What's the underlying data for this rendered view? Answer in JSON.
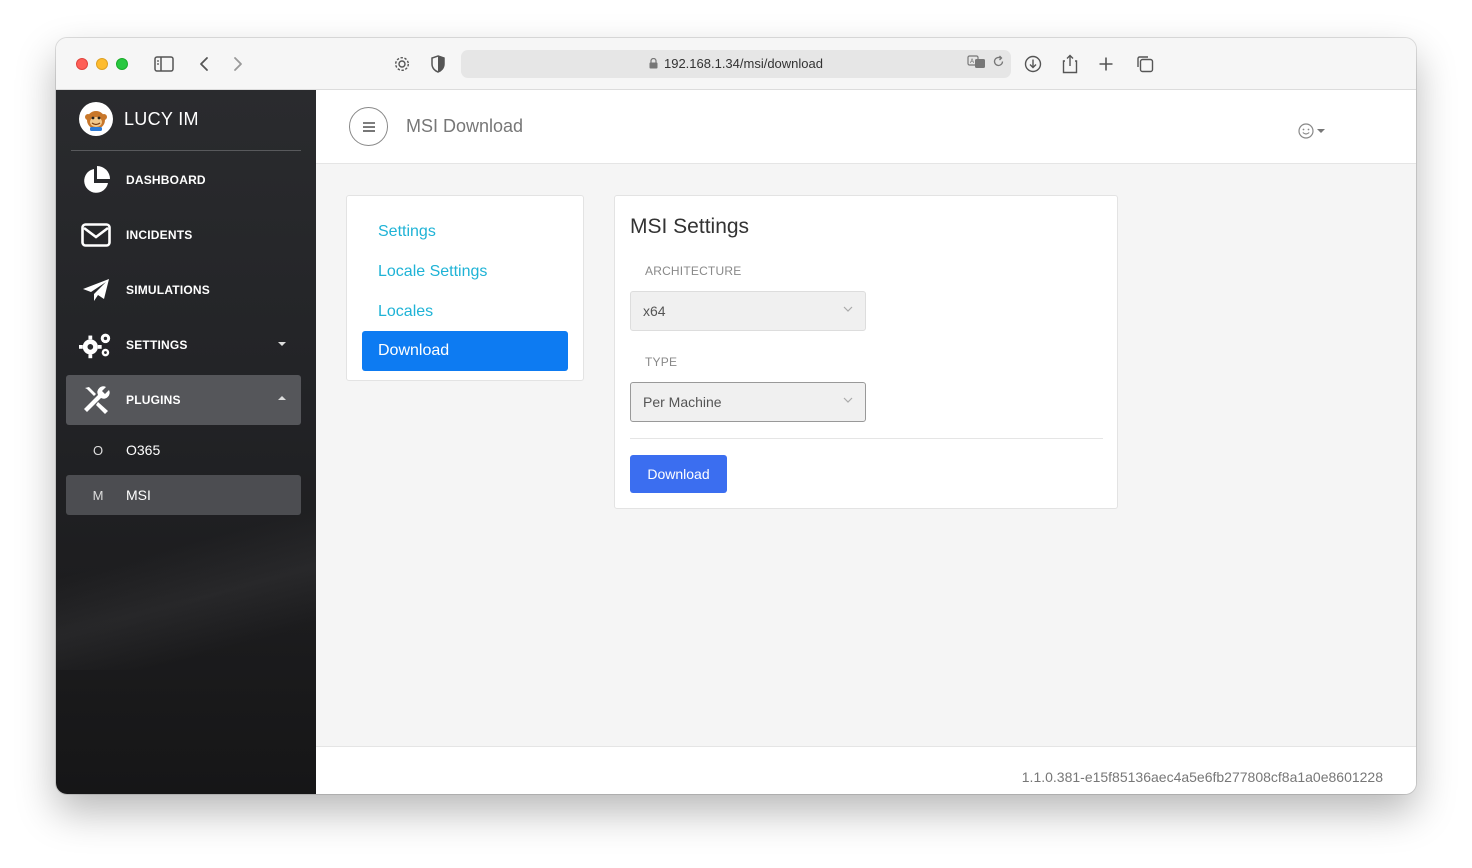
{
  "browser": {
    "url": "192.168.1.34/msi/download"
  },
  "sidebar": {
    "brand": "LUCY IM",
    "items": [
      {
        "label": "DASHBOARD",
        "icon": "pie-chart-icon"
      },
      {
        "label": "INCIDENTS",
        "icon": "envelope-icon"
      },
      {
        "label": "SIMULATIONS",
        "icon": "paper-plane-icon"
      },
      {
        "label": "SETTINGS",
        "icon": "gears-icon"
      },
      {
        "label": "PLUGINS",
        "icon": "tools-icon"
      }
    ],
    "subitems": [
      {
        "mini": "O",
        "label": "O365"
      },
      {
        "mini": "M",
        "label": "MSI"
      }
    ]
  },
  "header": {
    "title": "MSI Download"
  },
  "settings_nav": {
    "links": [
      "Settings",
      "Locale Settings",
      "Locales",
      "Download"
    ]
  },
  "form": {
    "title": "MSI Settings",
    "architecture_label": "ARCHITECTURE",
    "architecture_value": "x64",
    "type_label": "TYPE",
    "type_value": "Per Machine",
    "download_label": "Download"
  },
  "footer": {
    "version": "1.1.0.381-e15f85136aec4a5e6fb277808cf8a1a0e8601228"
  },
  "colors": {
    "sidebar_bg": "#222326",
    "link": "#1fb3d6",
    "active_nav": "#0d7bf2",
    "primary_button": "#3b6ef0"
  }
}
